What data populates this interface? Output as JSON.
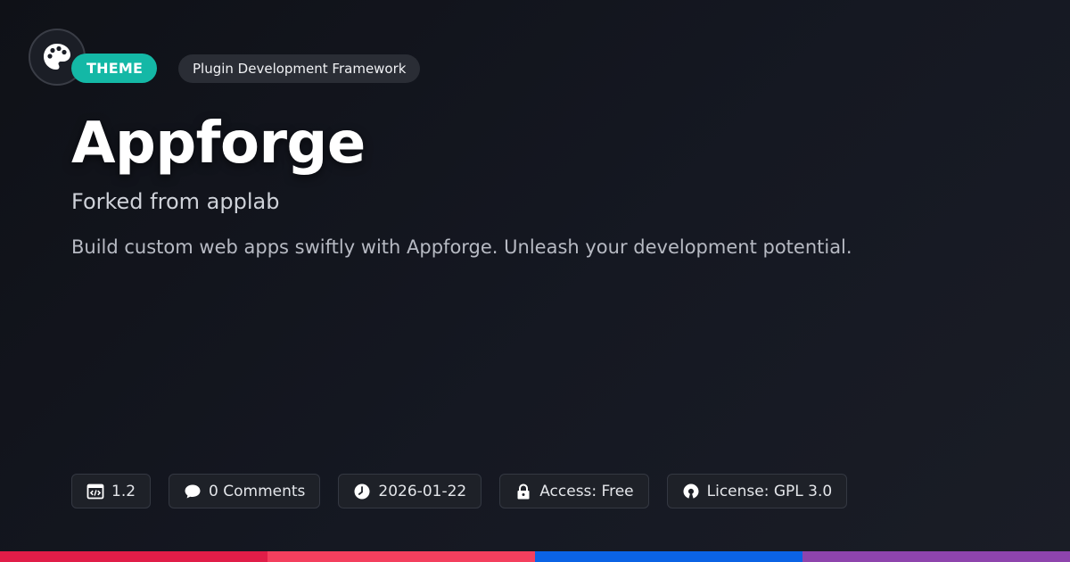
{
  "badges": {
    "type_label": "THEME",
    "category_label": "Plugin Development Framework"
  },
  "logo": {
    "icon": "palette-icon"
  },
  "header": {
    "title": "Appforge",
    "subtitle": "Forked from applab",
    "description": "Build custom web apps swiftly with Appforge. Unleash your development potential."
  },
  "meta": {
    "version": {
      "icon": "code-window-icon",
      "value": "1.2"
    },
    "comments": {
      "icon": "speech-bubble-icon",
      "value": "0 Comments"
    },
    "date": {
      "icon": "clock-icon",
      "value": "2026-01-22"
    },
    "access": {
      "icon": "lock-icon",
      "value": "Access: Free"
    },
    "license": {
      "icon": "open-source-icon",
      "value": "License: GPL 3.0"
    }
  },
  "colors": {
    "background": "#12141b",
    "accent_teal": "#14b8a6",
    "stripes": [
      "#e11d48",
      "#f43f5e",
      "#0b63e5",
      "#8e44ad"
    ]
  }
}
